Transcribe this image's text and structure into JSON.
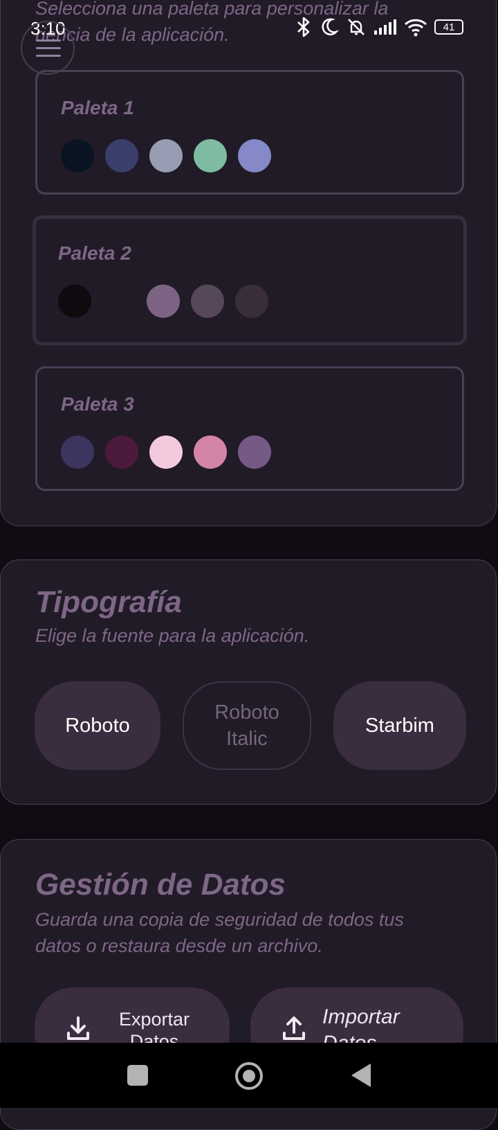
{
  "status": {
    "time": "3:10",
    "battery": "41"
  },
  "palettes_section": {
    "description_lines": [
      "Selecciona una paleta para personalizar la",
      "riencia de la aplicación."
    ],
    "palettes": [
      {
        "name": "Paleta 1",
        "selected": false,
        "colors": [
          "#0a1322",
          "#3a3f6b",
          "#979db3",
          "#7fbba3",
          "#8589c8"
        ]
      },
      {
        "name": "Paleta 2",
        "selected": true,
        "colors": [
          "#0f0a0f",
          "#211b27",
          "#7c6384",
          "#574859",
          "#3a2d3c"
        ]
      },
      {
        "name": "Paleta 3",
        "selected": false,
        "colors": [
          "#3b3560",
          "#4c1a3a",
          "#f4c9de",
          "#d483a9",
          "#755a86"
        ]
      }
    ]
  },
  "typography": {
    "title": "Tipografía",
    "description": "Elige la fuente para la aplicación.",
    "fonts": [
      {
        "label": "Roboto",
        "selected": true
      },
      {
        "label_lines": [
          "Roboto",
          "Italic"
        ],
        "selected": false
      },
      {
        "label": "Starbim",
        "selected": true
      }
    ]
  },
  "data_management": {
    "title": "Gestión de Datos",
    "description_lines": [
      "Guarda una copia de seguridad de todos tus",
      "datos o restaura desde un archivo."
    ],
    "export": {
      "label_lines": [
        "Exportar",
        "Datos"
      ],
      "icon": "download-icon"
    },
    "import": {
      "label_lines": [
        "Importar",
        "Datos"
      ],
      "icon": "upload-icon"
    }
  },
  "nav": {
    "icons": [
      "recents-square-icon",
      "home-circle-icon",
      "back-triangle-icon"
    ]
  }
}
